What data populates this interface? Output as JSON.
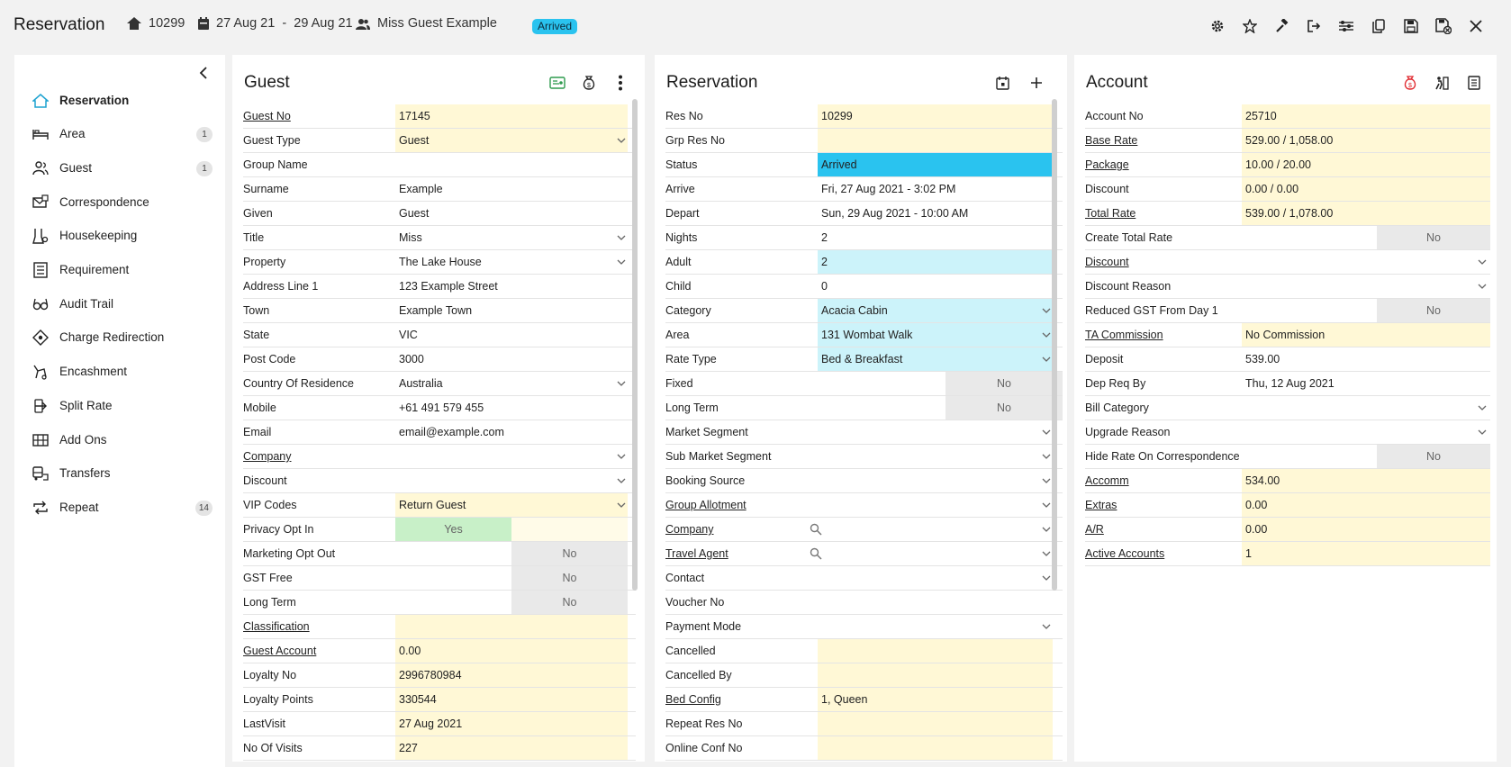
{
  "header": {
    "title": "Reservation",
    "res_no": "10299",
    "dates": "27 Aug 21  -  29 Aug 21",
    "guest": "Miss Guest Example",
    "status": "Arrived"
  },
  "toolbar": [
    "gear-icon",
    "star-icon",
    "gavel-icon",
    "logout-icon",
    "sliders-icon",
    "copy-icon",
    "save-icon",
    "save-close-icon",
    "close-icon"
  ],
  "sidebar": {
    "items": [
      {
        "label": "Reservation",
        "icon": "home-icon",
        "badge": ""
      },
      {
        "label": "Area",
        "icon": "bed-icon",
        "badge": "1"
      },
      {
        "label": "Guest",
        "icon": "users-icon",
        "badge": "1"
      },
      {
        "label": "Correspondence",
        "icon": "correspondence-icon",
        "badge": ""
      },
      {
        "label": "Housekeeping",
        "icon": "housekeeping-icon",
        "badge": ""
      },
      {
        "label": "Requirement",
        "icon": "requirement-icon",
        "badge": ""
      },
      {
        "label": "Audit Trail",
        "icon": "glasses-icon",
        "badge": ""
      },
      {
        "label": "Charge Redirection",
        "icon": "redirect-icon",
        "badge": ""
      },
      {
        "label": "Encashment",
        "icon": "encashment-icon",
        "badge": ""
      },
      {
        "label": "Split Rate",
        "icon": "split-icon",
        "badge": ""
      },
      {
        "label": "Add Ons",
        "icon": "addons-icon",
        "badge": ""
      },
      {
        "label": "Transfers",
        "icon": "transfers-icon",
        "badge": ""
      },
      {
        "label": "Repeat",
        "icon": "repeat-icon",
        "badge": "14"
      }
    ]
  },
  "guest_panel": {
    "title": "Guest",
    "rows": [
      {
        "label": "Guest No",
        "value": "17145",
        "link": true,
        "style": "yellow"
      },
      {
        "label": "Guest Type",
        "value": "Guest",
        "style": "yellow",
        "dropdown": true
      },
      {
        "label": "Group Name",
        "value": ""
      },
      {
        "label": "Surname",
        "value": "Example"
      },
      {
        "label": "Given",
        "value": "Guest"
      },
      {
        "label": "Title",
        "value": "Miss",
        "dropdown": true
      },
      {
        "label": "Property",
        "value": "The Lake House",
        "dropdown": true
      },
      {
        "label": "Address Line 1",
        "value": "123 Example Street"
      },
      {
        "label": "Town",
        "value": "Example Town"
      },
      {
        "label": "State",
        "value": "VIC"
      },
      {
        "label": "Post Code",
        "value": "3000"
      },
      {
        "label": "Country Of Residence",
        "value": "Australia",
        "dropdown": true
      },
      {
        "label": "Mobile",
        "value": "+61 491 579 455"
      },
      {
        "label": "Email",
        "value": "email@example.com"
      },
      {
        "label": "Company",
        "value": "",
        "link": true,
        "dropdown": true
      },
      {
        "label": "Discount",
        "value": "",
        "dropdown": true
      },
      {
        "label": "VIP Codes",
        "value": "Return Guest",
        "style": "yellow",
        "dropdown": true
      },
      {
        "label": "Privacy Opt In",
        "value": "Yes",
        "toggle": "yes"
      },
      {
        "label": "Marketing Opt Out",
        "value": "No",
        "toggle": "no"
      },
      {
        "label": "GST Free",
        "value": "No",
        "toggle": "no"
      },
      {
        "label": "Long Term",
        "value": "No",
        "toggle": "no"
      },
      {
        "label": "Classification",
        "value": "",
        "link": true,
        "style": "yellow"
      },
      {
        "label": "Guest Account",
        "value": "0.00",
        "link": true,
        "style": "yellow"
      },
      {
        "label": "Loyalty No",
        "value": "2996780984",
        "style": "yellow"
      },
      {
        "label": "Loyalty Points",
        "value": "330544",
        "style": "yellow"
      },
      {
        "label": "LastVisit",
        "value": "27 Aug 2021",
        "style": "yellow"
      },
      {
        "label": "No Of Visits",
        "value": "227",
        "style": "yellow"
      }
    ]
  },
  "reservation_panel": {
    "title": "Reservation",
    "rows": [
      {
        "label": "Res No",
        "value": "10299",
        "style": "yellow"
      },
      {
        "label": "Grp Res No",
        "value": "",
        "style": "yellow"
      },
      {
        "label": "Status",
        "value": "Arrived",
        "style": "blue"
      },
      {
        "label": "Arrive",
        "value": "Fri, 27 Aug 2021 - 3:02 PM"
      },
      {
        "label": "Depart",
        "value": "Sun, 29 Aug 2021 - 10:00 AM"
      },
      {
        "label": "Nights",
        "value": "2"
      },
      {
        "label": "Adult",
        "value": "2",
        "style": "lightblue"
      },
      {
        "label": "Child",
        "value": "0"
      },
      {
        "label": "Category",
        "value": "Acacia Cabin",
        "style": "lightblue",
        "dropdown": true
      },
      {
        "label": "Area",
        "value": "131 Wombat Walk",
        "style": "lightblue",
        "dropdown": true
      },
      {
        "label": "Rate Type",
        "value": "Bed & Breakfast",
        "style": "lightblue",
        "dropdown": true
      },
      {
        "label": "Fixed",
        "value": "No",
        "toggle": "no"
      },
      {
        "label": "Long Term",
        "value": "No",
        "toggle": "no"
      },
      {
        "label": "Market Segment",
        "value": "",
        "dropdown": true
      },
      {
        "label": "Sub Market Segment",
        "value": "",
        "dropdown": true
      },
      {
        "label": "Booking Source",
        "value": "",
        "dropdown": true
      },
      {
        "label": "Group Allotment",
        "value": "",
        "link": true,
        "dropdown": true
      },
      {
        "label": "Company",
        "value": "",
        "link": true,
        "dropdown": true,
        "search": true
      },
      {
        "label": "Travel Agent",
        "value": "",
        "link": true,
        "dropdown": true,
        "search": true
      },
      {
        "label": "Contact",
        "value": "",
        "dropdown": true
      },
      {
        "label": "Voucher No",
        "value": ""
      },
      {
        "label": "Payment Mode",
        "value": "",
        "dropdown": true
      },
      {
        "label": "Cancelled",
        "value": "",
        "style": "yellow"
      },
      {
        "label": "Cancelled By",
        "value": "",
        "style": "yellow"
      },
      {
        "label": "Bed Config",
        "value": "1, Queen",
        "link": true,
        "style": "yellow"
      },
      {
        "label": "Repeat Res No",
        "value": "",
        "style": "yellow"
      },
      {
        "label": "Online Conf No",
        "value": "",
        "style": "yellow"
      }
    ]
  },
  "account_panel": {
    "title": "Account",
    "rows": [
      {
        "label": "Account No",
        "value": "25710",
        "style": "yellow"
      },
      {
        "label": "Base Rate",
        "value": "529.00 / 1,058.00",
        "link": true,
        "style": "yellow"
      },
      {
        "label": "Package",
        "value": "10.00 / 20.00",
        "link": true,
        "style": "yellow"
      },
      {
        "label": "Discount",
        "value": "0.00 / 0.00",
        "style": "yellow"
      },
      {
        "label": "Total Rate",
        "value": "539.00 / 1,078.00",
        "link": true,
        "style": "yellow"
      },
      {
        "label": "Create Total Rate",
        "value": "No",
        "toggle": "no"
      },
      {
        "label": "Discount",
        "value": "",
        "link": true,
        "dropdown": true
      },
      {
        "label": "Discount Reason",
        "value": "",
        "dropdown": true
      },
      {
        "label": "Reduced GST From Day 1",
        "value": "No",
        "toggle": "no"
      },
      {
        "label": "TA Commission",
        "value": "No Commission",
        "link": true,
        "style": "yellow"
      },
      {
        "label": "Deposit",
        "value": "539.00"
      },
      {
        "label": "Dep Req By",
        "value": "Thu, 12 Aug 2021"
      },
      {
        "label": "Bill Category",
        "value": "",
        "dropdown": true
      },
      {
        "label": "Upgrade Reason",
        "value": "",
        "dropdown": true
      },
      {
        "label": "Hide Rate On Correspondence",
        "value": "No",
        "toggle": "no"
      },
      {
        "label": "Accomm",
        "value": "534.00",
        "link": true,
        "style": "yellow"
      },
      {
        "label": "Extras",
        "value": "0.00",
        "link": true,
        "style": "yellow"
      },
      {
        "label": "A/R",
        "value": "0.00",
        "link": true,
        "style": "yellow"
      },
      {
        "label": "Active Accounts",
        "value": "1",
        "link": true,
        "style": "yellow"
      }
    ]
  },
  "colors": {
    "accent_blue": "#2ac3ef",
    "yellow_field": "#fff8d6",
    "light_blue_field": "#ccf3fa",
    "toggle_gray": "#e9e9e9",
    "toggle_green": "#c8f0c8"
  }
}
